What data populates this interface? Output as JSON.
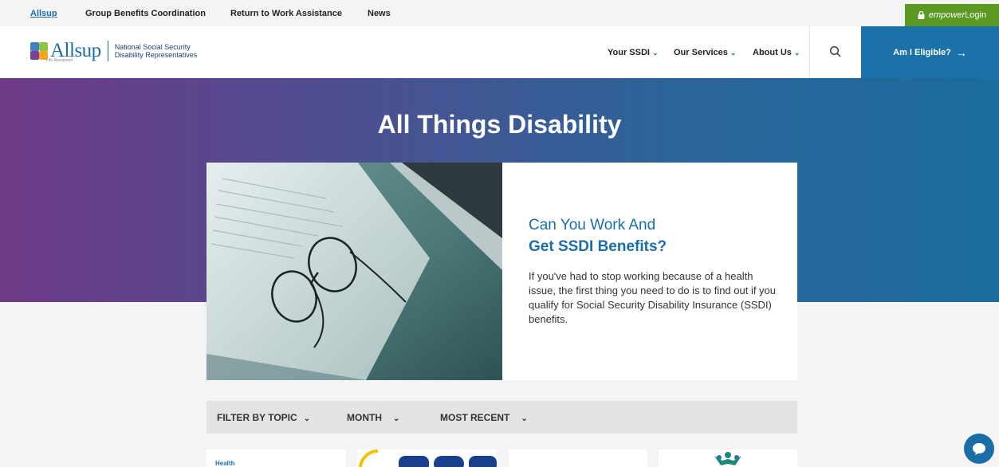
{
  "topbar": {
    "links": [
      "Allsup",
      "Group Benefits Coordination",
      "Return to Work Assistance",
      "News"
    ],
    "login_brand": "empower",
    "login_label": "Login"
  },
  "header": {
    "logo_word": "Allsup",
    "logo_tagline": "Life Reclaimed",
    "logo_sub_line1": "National Social Security",
    "logo_sub_line2": "Disability Representatives",
    "nav": [
      "Your SSDI",
      "Our Services",
      "About Us"
    ],
    "cta_label": "Am I Eligible?"
  },
  "hero": {
    "title": "All Things Disability"
  },
  "feature": {
    "title_line1": "Can You Work And",
    "title_line2": "Get SSDI Benefits?",
    "description": "If you've had to stop working because of a health issue, the first thing you need to do is to find out if you qualify for Social Security Disability Insurance (SSDI) benefits."
  },
  "filters": {
    "topic": "FILTER BY TOPIC",
    "month": "MONTH",
    "sort": "MOST RECENT"
  },
  "cards": {
    "first_tag": "Health"
  },
  "colors": {
    "brand_blue": "#1a6ea8",
    "empower_green": "#5a9a22",
    "hero_start": "#6e3a86",
    "hero_end": "#1b6c9f"
  }
}
